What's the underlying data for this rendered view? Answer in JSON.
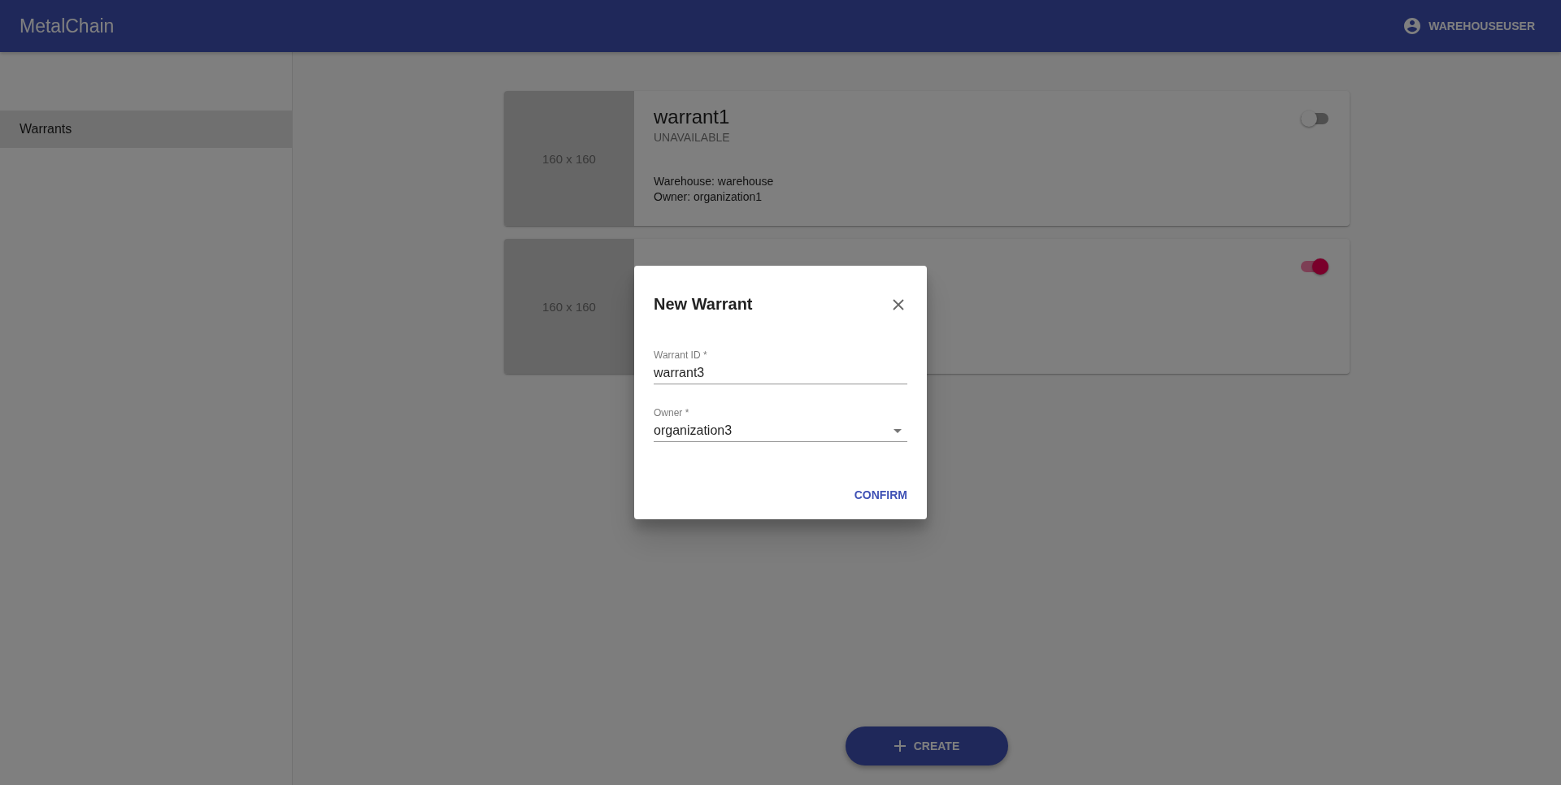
{
  "app_bar": {
    "title": "MetalChain",
    "user": "WAREHOUSEUSER"
  },
  "sidebar": {
    "items": [
      {
        "label": "Warrants",
        "selected": true
      }
    ]
  },
  "cards": [
    {
      "image_label": "160 x 160",
      "title": "warrant1",
      "status": "UNAVAILABLE",
      "lines": [
        "Warehouse: warehouse",
        "Owner: organization1"
      ],
      "on": false
    },
    {
      "image_label": "160 x 160",
      "on": true
    }
  ],
  "create_button": {
    "label": "CREATE"
  },
  "dialog": {
    "title": "New Warrant",
    "fields": [
      {
        "kind": "text",
        "label": "Warrant ID *",
        "value": "warrant3"
      },
      {
        "kind": "select",
        "label": "Owner *",
        "value": "organization3"
      }
    ],
    "confirm": "CONFIRM"
  }
}
